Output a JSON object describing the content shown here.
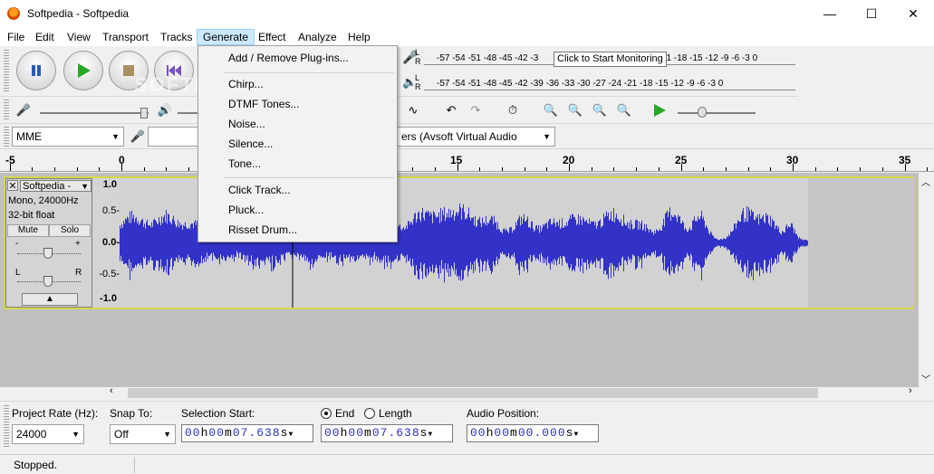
{
  "window": {
    "title": "Softpedia - Softpedia",
    "minimize_glyph": "—",
    "maximize_glyph": "☐",
    "close_glyph": "✕"
  },
  "menubar": [
    "File",
    "Edit",
    "View",
    "Transport",
    "Tracks",
    "Generate",
    "Effect",
    "Analyze",
    "Help"
  ],
  "generate_menu": {
    "group1": [
      "Add / Remove Plug-ins..."
    ],
    "group2": [
      "Chirp...",
      "DTMF Tones...",
      "Noise...",
      "Silence...",
      "Tone..."
    ],
    "group3": [
      "Click Track...",
      "Pluck...",
      "Risset Drum..."
    ]
  },
  "meters": {
    "record_scale": "-57 -54 -51 -48 -45 -42 -3",
    "record_scale_right": "21 -18 -15 -12  -9  -6  -3  0",
    "playback_scale": "-57 -54 -51 -48 -45 -42 -39 -36 -33 -30 -27 -24 -21 -18 -15 -12  -9  -6  -3  0",
    "tooltip": "Click to Start Monitoring",
    "L": "L",
    "R": "R"
  },
  "device": {
    "host": "MME",
    "output": "ers (Avsoft Virtual Audio"
  },
  "ruler": {
    "labels": [
      "-5",
      "0",
      "15",
      "20",
      "25",
      "30",
      "35"
    ]
  },
  "track": {
    "name": "Softpedia -",
    "format": "Mono, 24000Hz",
    "bitdepth": "32-bit float",
    "mute": "Mute",
    "solo": "Solo",
    "gain_minus": "-",
    "gain_plus": "+",
    "pan_left": "L",
    "pan_right": "R",
    "scale": [
      "1.0",
      "0.5-",
      "0.0-",
      "-0.5-",
      "-1.0"
    ],
    "wave_color": "#3232c8",
    "selection_pos": 0.218
  },
  "selection_toolbar": {
    "project_rate_label": "Project Rate (Hz):",
    "project_rate_value": "24000",
    "snap_label": "Snap To:",
    "snap_value": "Off",
    "sel_start_label": "Selection Start:",
    "end_label": "End",
    "length_label": "Length",
    "audio_pos_label": "Audio Position:",
    "start_time": {
      "h": "00",
      "m": "00",
      "s": "07.638"
    },
    "end_time": {
      "h": "00",
      "m": "00",
      "s": "07.638"
    },
    "audio_time": {
      "h": "00",
      "m": "00",
      "s": "00.000"
    }
  },
  "status": "Stopped.",
  "watermark": "SOFTPEDIA"
}
